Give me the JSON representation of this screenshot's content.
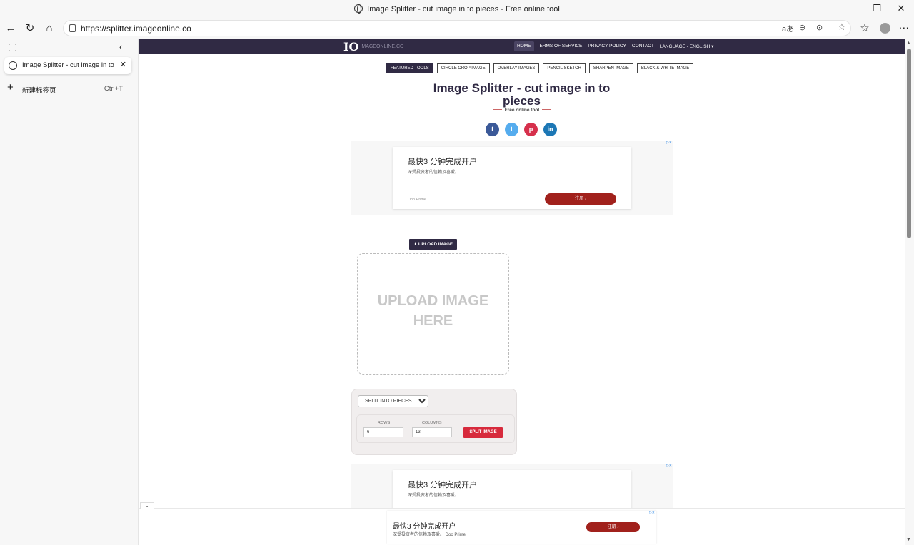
{
  "browser": {
    "window_title": "Image Splitter - cut image in to pieces - Free online tool",
    "url": "https://splitter.imageonline.co",
    "reader_label": "aあ",
    "tab_title": "Image Splitter - cut image in to pieces",
    "new_tab_label": "新建标签页",
    "new_tab_shortcut": "Ctrl+T"
  },
  "site": {
    "logo": "IO",
    "logo_sub": "IMAGEONLINE.CO",
    "menu": [
      "HOME",
      "TERMS OF SERVICE",
      "PRIVACY POLICY",
      "CONTACT",
      "LANGUAGE - ENGLISH ▾"
    ],
    "tools": [
      "FEATURED TOOLS",
      "CIRCLE CROP IMAGE",
      "OVERLAY IMAGES",
      "PENCIL SKETCH",
      "SHARPEN IMAGE",
      "BLACK & WHITE IMAGE"
    ],
    "title": "Image Splitter - cut image in to pieces",
    "subtitle": "Free online tool",
    "social": [
      {
        "label": "f",
        "color": "#3b5998"
      },
      {
        "label": "t",
        "color": "#55acee"
      },
      {
        "label": "p",
        "color": "#d6304c"
      },
      {
        "label": "in",
        "color": "#1c77b5"
      }
    ]
  },
  "ads": {
    "headline": "最快3 分钟完成开户",
    "text": "深受投资者的信赖及喜爱。",
    "brand": "Doo Prime",
    "cta": "注册  ›",
    "bottom_text": "深受投资者的信赖及喜爱。 Doo Prime"
  },
  "tool": {
    "upload_button": "⬆ UPLOAD IMAGE",
    "dropzone_text": "UPLOAD IMAGE HERE",
    "mode": "SPLIT INTO PIECES",
    "rows_label": "ROWS",
    "rows_value": "6",
    "columns_label": "COLUMNS",
    "columns_value": "13",
    "split_button": "SPLIT IMAGE"
  }
}
